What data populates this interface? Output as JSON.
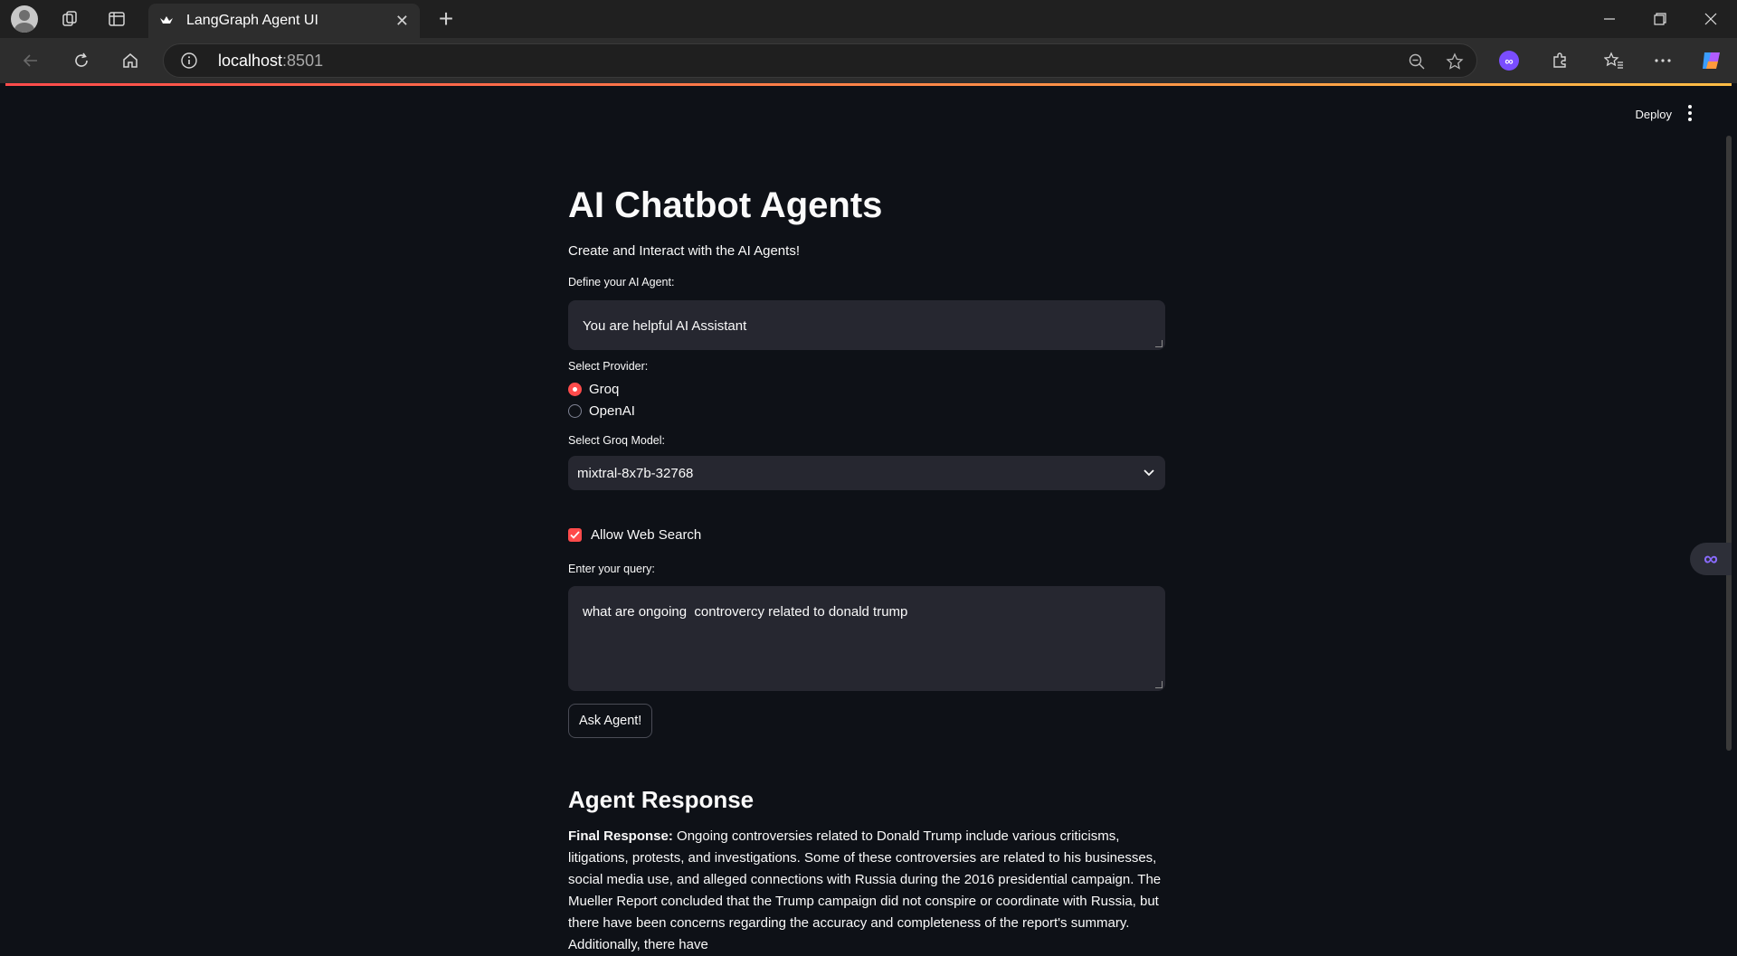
{
  "browser": {
    "tab_title": "LangGraph Agent UI",
    "tab_close": "✕",
    "new_tab": "+",
    "address_host": "localhost",
    "address_port": ":8501"
  },
  "app": {
    "deploy_label": "Deploy",
    "title": "AI Chatbot Agents",
    "subtitle": "Create and Interact with the AI Agents!",
    "system_prompt": {
      "label": "Define your AI Agent:",
      "value": "You are helpful AI Assistant"
    },
    "provider": {
      "label": "Select Provider:",
      "options": [
        "Groq",
        "OpenAI"
      ],
      "selected": "Groq"
    },
    "model": {
      "label": "Select Groq Model:",
      "value": "mixtral-8x7b-32768"
    },
    "web_search": {
      "label": "Allow Web Search",
      "checked": true
    },
    "query": {
      "label": "Enter your query:",
      "value": "what are ongoing  controvercy related to donald trump"
    },
    "ask_button": "Ask Agent!",
    "response_heading": "Agent Response",
    "response_prefix": "Final Response:",
    "response_text": " Ongoing controversies related to Donald Trump include various criticisms, litigations, protests, and investigations. Some of these controversies are related to his businesses, social media use, and alleged connections with Russia during the 2016 presidential campaign. The Mueller Report concluded that the Trump campaign did not conspire or coordinate with Russia, but there have been concerns regarding the accuracy and completeness of the report's summary. Additionally, there have"
  },
  "colors": {
    "accent": "#ff4b4b",
    "background": "#0e1117",
    "widget_bg": "#262730"
  }
}
